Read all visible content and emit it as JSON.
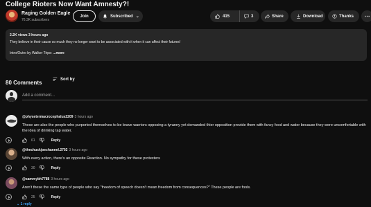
{
  "video": {
    "title": "College Rioters Now Want Amnesty?!"
  },
  "channel": {
    "name": "Raging Golden Eagle",
    "subscribers": "76.3K subscribers",
    "join_label": "Join",
    "subscribed_label": "Subscribed"
  },
  "actions": {
    "likes": "415",
    "comments": "3",
    "share_label": "Share",
    "download_label": "Download",
    "thanks_label": "Thanks",
    "more_label": "⋯"
  },
  "description": {
    "meta": "2.2K views  3 hours ago",
    "text": "They believe in their cause so much they no longer want to be associated with it when it can affect their futures!",
    "line3": "Intro/Outro by Walker Trips:",
    "more_label": "...more"
  },
  "comments_section": {
    "count_label": "80 Comments",
    "sort_label": "Sort by",
    "add_placeholder": "Add a comment...",
    "items": [
      {
        "handle": "@physetermacrocephalus2209",
        "time": "3 hours ago",
        "text": "These are also the people who purported themselves to be brave warriors opposing a tyranny yet demanded thier opposition provide them with fancy food and water because they were uncomfortable with the idea of drinking tap water.",
        "likes": "61",
        "reply_label": "Reply"
      },
      {
        "handle": "@thechuckjoechannel.2702",
        "time": "3 hours ago",
        "text": "With every action, there's an opposite Reaction. No sympathy for these protesters",
        "likes": "30",
        "reply_label": "Reply"
      },
      {
        "handle": "@sammybh7788",
        "time": "3 hours ago",
        "text": "Aren't these the same type of people who say \"freedom of speech doesn't mean freedom from consequences?\"  These people are fools.",
        "likes": "25",
        "reply_label": "Reply",
        "replies_label": "1 reply"
      }
    ]
  },
  "colors": {
    "background": "#0f0f0f",
    "pill": "#272727",
    "link": "#3ea6ff",
    "secondary_text": "#aaaaaa"
  }
}
